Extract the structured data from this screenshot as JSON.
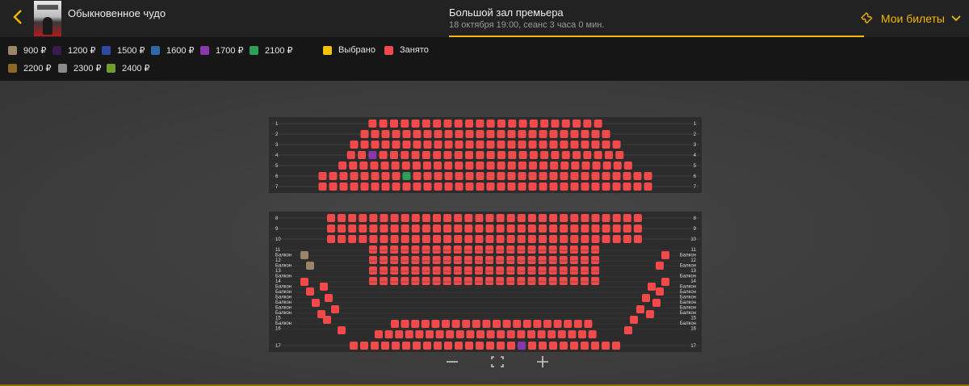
{
  "header": {
    "back_icon": "chevron-left-icon",
    "show_title": "Обыкновенное чудо",
    "hall": "Большой зал премьера",
    "session": "18 октября 19:00, сеанс 3 часа 0 мин.",
    "tickets_label": "Мои билеты",
    "tickets_icon": "ticket-icon"
  },
  "legend": [
    {
      "label": "900 ₽",
      "color": "#9c8468"
    },
    {
      "label": "1200 ₽",
      "color": "#3a1d4f"
    },
    {
      "label": "1500 ₽",
      "color": "#2e4aa0"
    },
    {
      "label": "1600 ₽",
      "color": "#2c6aa8"
    },
    {
      "label": "1700 ₽",
      "color": "#8a36ad"
    },
    {
      "label": "2100 ₽",
      "color": "#2f9e57"
    },
    {
      "label": "Выбрано",
      "color": "#f5c200"
    },
    {
      "label": "Занято",
      "color": "#f24a4a"
    },
    {
      "label": "2200 ₽",
      "color": "#8d6a24"
    },
    {
      "label": "2300 ₽",
      "color": "#8a8a8a"
    },
    {
      "label": "2400 ₽",
      "color": "#6f9e2f"
    }
  ],
  "seatmap": {
    "occupied_color": "#f24a4a",
    "row_labels_top": [
      "1",
      "2",
      "3",
      "4",
      "5",
      "6",
      "7"
    ],
    "row_labels_mid": [
      "8",
      "9",
      "10"
    ],
    "balcony_left": [
      "11",
      "Балкон",
      "12",
      "Балкон",
      "13",
      "Балкон",
      "14",
      "Балкон",
      "Балкон",
      "Балкон",
      "Балкон",
      "Балкон",
      "Балкон",
      "15",
      "Балкон",
      "16"
    ],
    "balcony_right": [
      "11",
      "Балкон",
      "12",
      "Балкон",
      "13",
      "Балкон",
      "14",
      "Балкон",
      "Балкон",
      "Балкон",
      "Балкон",
      "Балкон",
      "Балкон",
      "15",
      "Балкон",
      "16"
    ],
    "row_label_last": "17"
  },
  "zoom": {
    "zoom_out_icon": "minus-icon",
    "fit_icon": "fullscreen-icon",
    "zoom_in_icon": "plus-icon"
  }
}
